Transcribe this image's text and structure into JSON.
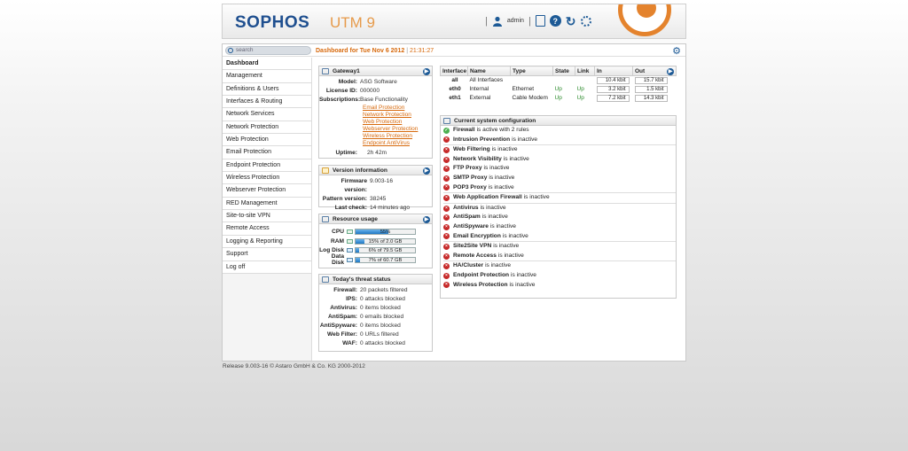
{
  "header": {
    "logo": "SOPHOS",
    "product": "UTM 9",
    "user": "admin"
  },
  "topbar": {
    "search_placeholder": "search",
    "dashboard_label": "Dashboard for Tue Nov 6 2012",
    "time": "21:31:27"
  },
  "sidebar": {
    "items": [
      {
        "label": "Dashboard"
      },
      {
        "label": "Management"
      },
      {
        "label": "Definitions & Users"
      },
      {
        "label": "Interfaces & Routing"
      },
      {
        "label": "Network Services"
      },
      {
        "label": "Network Protection"
      },
      {
        "label": "Web Protection"
      },
      {
        "label": "Email Protection"
      },
      {
        "label": "Endpoint Protection"
      },
      {
        "label": "Wireless Protection"
      },
      {
        "label": "Webserver Protection"
      },
      {
        "label": "RED Management"
      },
      {
        "label": "Site-to-site VPN"
      },
      {
        "label": "Remote Access"
      },
      {
        "label": "Logging & Reporting"
      },
      {
        "label": "Support"
      },
      {
        "label": "Log off"
      }
    ]
  },
  "gateway": {
    "title": "Gateway1",
    "model_k": "Model:",
    "model_v": "ASG Software",
    "license_k": "License ID:",
    "license_v": "000000",
    "subs_k": "Subscriptions:",
    "subs_v": "Base Functionality",
    "subs_links": [
      "Email Protection",
      "Network Protection",
      "Web Protection",
      "Webserver Protection",
      "Wireless Protection",
      "Endpoint AntiVirus"
    ],
    "uptime_k": "Uptime:",
    "uptime_v": "2h 42m"
  },
  "version": {
    "title": "Version information",
    "fw_k": "Firmware version:",
    "fw_v": "9.003-16",
    "pat_k": "Pattern version:",
    "pat_v": "38245",
    "chk_k": "Last check:",
    "chk_v": "14 minutes ago"
  },
  "resources": {
    "title": "Resource usage",
    "rows": [
      {
        "label": "CPU",
        "text": "55%",
        "fill": 0.55
      },
      {
        "label": "RAM",
        "text": "15% of 2.0 GB",
        "fill": 0.15
      },
      {
        "label": "Log Disk",
        "text": "6% of 79.5 GB",
        "fill": 0.06
      },
      {
        "label": "Data Disk",
        "text": "7% of 60.7 GB",
        "fill": 0.07
      }
    ]
  },
  "threat": {
    "title": "Today's threat status",
    "rows": [
      {
        "k": "Firewall:",
        "v": "20 packets filtered"
      },
      {
        "k": "IPS:",
        "v": "0 attacks blocked"
      },
      {
        "k": "Antivirus:",
        "v": "0 items blocked"
      },
      {
        "k": "AntiSpam:",
        "v": "0 emails blocked"
      },
      {
        "k": "AntiSpyware:",
        "v": "0 items blocked"
      },
      {
        "k": "Web Filter:",
        "v": "0 URLs filtered"
      },
      {
        "k": "WAF:",
        "v": "0 attacks blocked"
      }
    ]
  },
  "interfaces": {
    "headers": [
      "Interface",
      "Name",
      "Type",
      "State",
      "Link",
      "In",
      "Out"
    ],
    "rows": [
      {
        "iface": "all",
        "name": "All Interfaces",
        "type": "",
        "state": "",
        "link": "",
        "in": "10.4 kbit",
        "out": "15.7 kbit"
      },
      {
        "iface": "eth0",
        "name": "Internal",
        "type": "Ethernet",
        "state": "Up",
        "link": "Up",
        "in": "3.2 kbit",
        "out": "1.5 kbit"
      },
      {
        "iface": "eth1",
        "name": "External",
        "type": "Cable Modem",
        "state": "Up",
        "link": "Up",
        "in": "7.2 kbit",
        "out": "14.3 kbit"
      }
    ]
  },
  "config": {
    "title": "Current system configuration",
    "groups": [
      [
        {
          "name": "Firewall",
          "status": "is active with 2 rules",
          "ok": true
        },
        {
          "name": "Intrusion Prevention",
          "status": "is inactive",
          "ok": false
        }
      ],
      [
        {
          "name": "Web Filtering",
          "status": "is inactive",
          "ok": false
        },
        {
          "name": "Network Visibility",
          "status": "is inactive",
          "ok": false
        },
        {
          "name": "FTP Proxy",
          "status": "is inactive",
          "ok": false
        },
        {
          "name": "SMTP Proxy",
          "status": "is inactive",
          "ok": false
        },
        {
          "name": "POP3 Proxy",
          "status": "is inactive",
          "ok": false
        }
      ],
      [
        {
          "name": "Web Application Firewall",
          "status": "is inactive",
          "ok": false
        }
      ],
      [
        {
          "name": "Antivirus",
          "status": "is inactive",
          "ok": false
        },
        {
          "name": "AntiSpam",
          "status": "is inactive",
          "ok": false
        },
        {
          "name": "AntiSpyware",
          "status": "is inactive",
          "ok": false
        },
        {
          "name": "Email Encryption",
          "status": "is inactive",
          "ok": false
        }
      ],
      [
        {
          "name": "Site2Site VPN",
          "status": "is inactive",
          "ok": false
        },
        {
          "name": "Remote Access",
          "status": "is inactive",
          "ok": false
        }
      ],
      [
        {
          "name": "HA/Cluster",
          "status": "is inactive",
          "ok": false
        },
        {
          "name": "Endpoint Protection",
          "status": "is inactive",
          "ok": false
        },
        {
          "name": "Wireless Protection",
          "status": "is inactive",
          "ok": false
        }
      ]
    ]
  },
  "footer": {
    "text": "Release 9.003-16  © Astaro GmbH & Co. KG 2000-2012"
  }
}
